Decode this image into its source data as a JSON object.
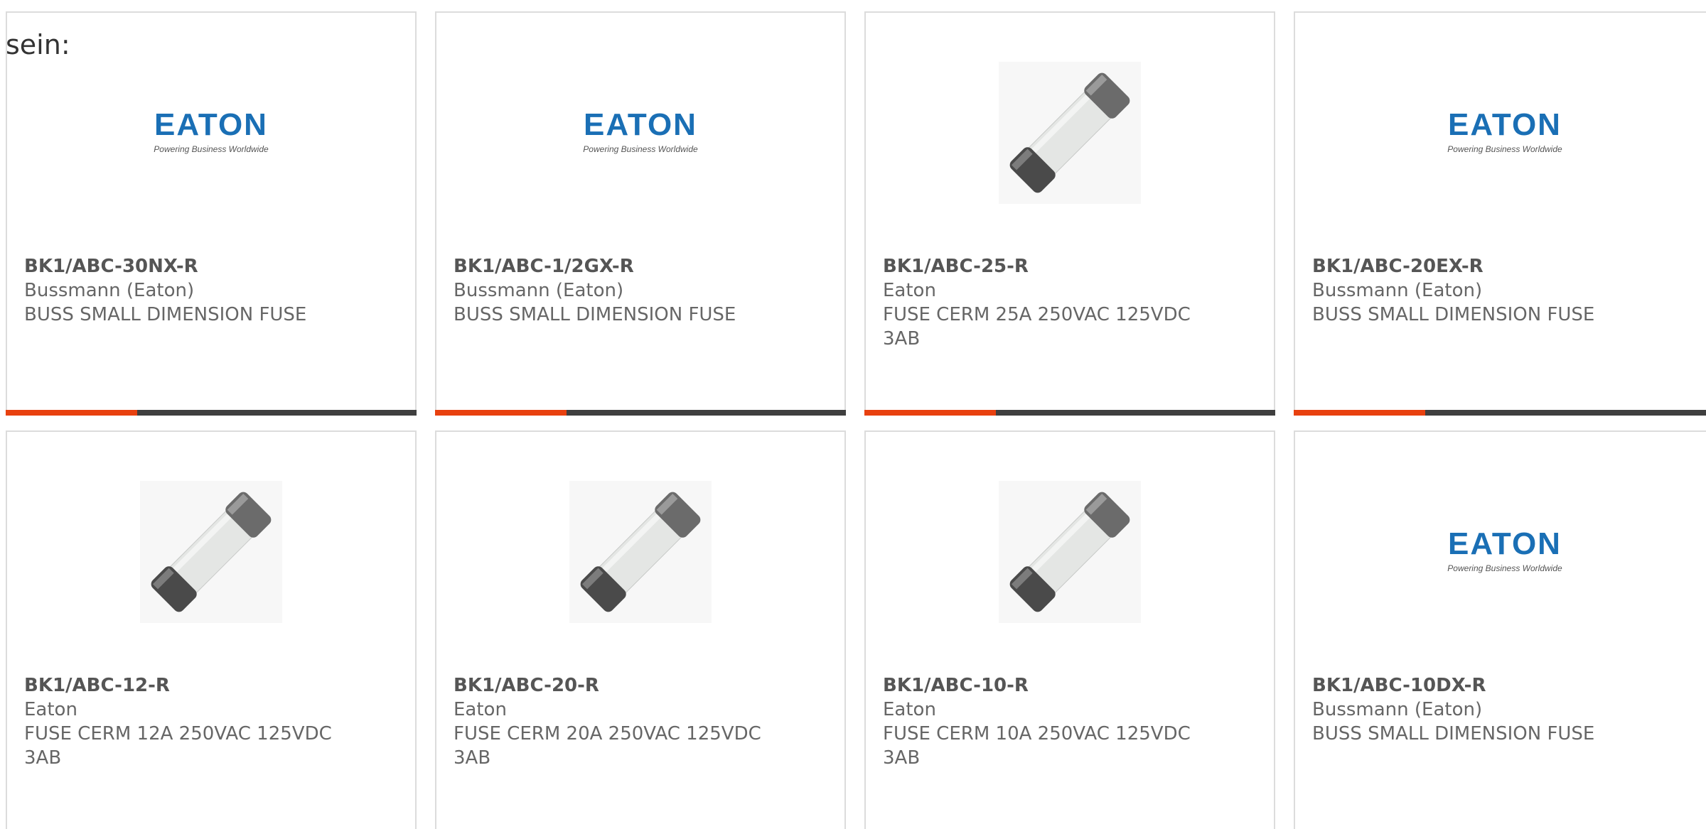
{
  "intro_text": "sein:",
  "colors": {
    "accent": "#e8410f",
    "bar": "#3f3f3f",
    "eaton_blue": "#1a6fb5",
    "card_border": "#dcdcdc"
  },
  "logo": {
    "wordmark": "EATON",
    "tagline": "Powering Business Worldwide"
  },
  "products": [
    {
      "part_number": "BK1/ABC-30NX-R",
      "manufacturer": "Bussmann (Eaton)",
      "description": "BUSS SMALL DIMENSION FUSE",
      "image": "eaton-logo"
    },
    {
      "part_number": "BK1/ABC-1/2GX-R",
      "manufacturer": "Bussmann (Eaton)",
      "description": "BUSS SMALL DIMENSION FUSE",
      "image": "eaton-logo"
    },
    {
      "part_number": "BK1/ABC-25-R",
      "manufacturer": "Eaton",
      "description": "FUSE CERM 25A 250VAC 125VDC 3AB",
      "image": "fuse-photo"
    },
    {
      "part_number": "BK1/ABC-20EX-R",
      "manufacturer": "Bussmann (Eaton)",
      "description": "BUSS SMALL DIMENSION FUSE",
      "image": "eaton-logo"
    },
    {
      "part_number": "BK1/ABC-12-R",
      "manufacturer": "Eaton",
      "description": "FUSE CERM 12A 250VAC 125VDC 3AB",
      "image": "fuse-photo"
    },
    {
      "part_number": "BK1/ABC-20-R",
      "manufacturer": "Eaton",
      "description": "FUSE CERM 20A 250VAC 125VDC 3AB",
      "image": "fuse-photo"
    },
    {
      "part_number": "BK1/ABC-10-R",
      "manufacturer": "Eaton",
      "description": "FUSE CERM 10A 250VAC 125VDC 3AB",
      "image": "fuse-photo"
    },
    {
      "part_number": "BK1/ABC-10DX-R",
      "manufacturer": "Bussmann (Eaton)",
      "description": "BUSS SMALL DIMENSION FUSE",
      "image": "eaton-logo"
    }
  ]
}
